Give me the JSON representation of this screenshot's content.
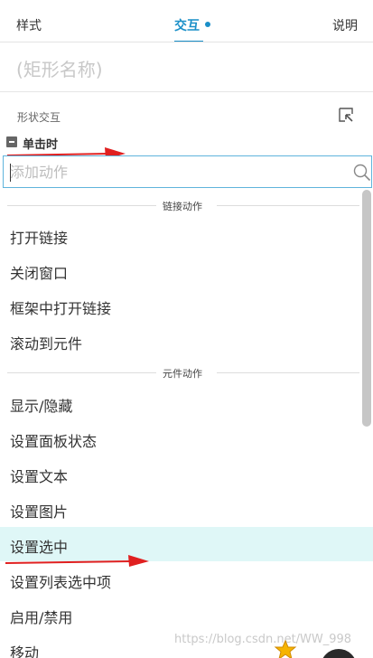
{
  "tabs": [
    {
      "label": "样式"
    },
    {
      "label": "交互"
    },
    {
      "label": "说明"
    }
  ],
  "active_tab": "交互",
  "accent_color": "#1a8fc8",
  "shape_name": "(矩形名称)",
  "section_label": "形状交互",
  "event_label": "单击时",
  "search": {
    "placeholder": "添加动作",
    "value": ""
  },
  "groups": [
    {
      "title": "链接动作",
      "items": [
        "打开链接",
        "关闭窗口",
        "框架中打开链接",
        "滚动到元件"
      ]
    },
    {
      "title": "元件动作",
      "items": [
        "显示/隐藏",
        "设置面板状态",
        "设置文本",
        "设置图片",
        "设置选中",
        "设置列表选中项",
        "启用/禁用",
        "移动"
      ]
    }
  ],
  "selected_item": "设置选中",
  "highlight_color": "#dff7f7",
  "annotation_color": "#e02020",
  "icons": [
    "corner-select-icon",
    "collapse-minus-icon",
    "search-icon"
  ],
  "watermark": "https://blog.csdn.net/WW_998"
}
